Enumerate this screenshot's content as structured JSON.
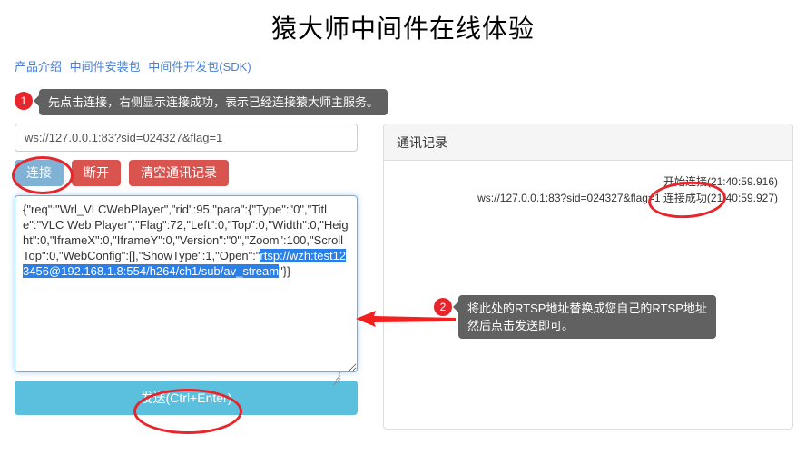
{
  "header": {
    "title": "猿大师中间件在线体验",
    "nav": [
      {
        "label": "产品介绍"
      },
      {
        "label": "中间件安装包"
      },
      {
        "label": "中间件开发包(SDK)"
      }
    ]
  },
  "left_panel": {
    "url_input": {
      "value": "ws://127.0.0.1:83?sid=024327&flag=1",
      "placeholder": "ws://"
    },
    "buttons": {
      "connect": "连接",
      "disconnect": "断开",
      "clear_log": "清空通讯记录",
      "send": "发送(Ctrl+Enter)"
    },
    "message_textarea": {
      "prefix": "{\"req\":\"Wrl_VLCWebPlayer\",\"rid\":95,\"para\":{\"Type\":\"0\",\"Title\":\"VLC Web Player\",\"Flag\":72,\"Left\":0,\"Top\":0,\"Width\":0,\"Height\":0,\"IframeX\":0,\"IframeY\":0,\"Version\":\"0\",\"Zoom\":100,\"ScrollTop\":0,\"WebConfig\":[],\"ShowType\":1,\"Open\":\"",
      "selected": "rtsp://wzh:test123456@192.168.1.8:554/h264/ch1/sub/av_stream",
      "suffix": "\"}}"
    }
  },
  "right_panel": {
    "card_title": "通讯记录",
    "log_lines": [
      "开始连接(21:40:59.916)",
      "ws://127.0.0.1:83?sid=024327&flag=1 连接成功(21:40:59.927)"
    ]
  },
  "callouts": [
    {
      "number": "1",
      "text": "先点击连接，右侧显示连接成功，表示已经连接猿大师主服务。"
    },
    {
      "number": "2",
      "text": "将此处的RTSP地址替换成您自己的RTSP地址\n然后点击发送即可。"
    }
  ],
  "colors": {
    "accent_red": "#e8252a",
    "danger_button": "#d9534f",
    "send_button": "#5bc0de",
    "connect_button": "#7fb2d4",
    "link": "#4a7fd4",
    "bubble_bg": "#616161",
    "selection_bg": "#2a7fe8"
  }
}
